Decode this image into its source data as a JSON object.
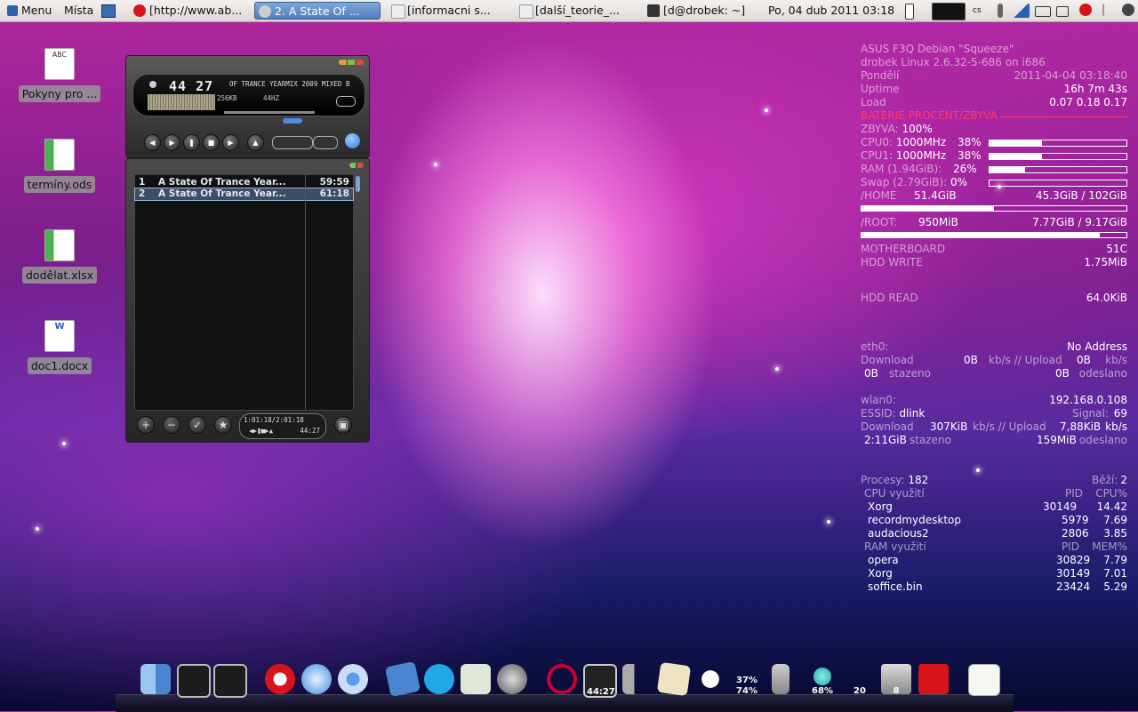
{
  "panel": {
    "menu_label": "Menu",
    "places_label": "Místa",
    "tasks": [
      {
        "label": "[http://www.ab..."
      },
      {
        "label": "2. A State Of ..."
      },
      {
        "label": "[informacni s..."
      },
      {
        "label": "[další_teorie_..."
      },
      {
        "label": "[d@drobek: ~]"
      }
    ],
    "clock": "Po, 04 dub 2011  03:18",
    "keyboard_layout": "cs"
  },
  "desktop_icons": [
    {
      "label": "Pokyny pro ...",
      "icon": "text-document-icon",
      "badge": "ABC"
    },
    {
      "label": "termíny.ods",
      "icon": "spreadsheet-icon"
    },
    {
      "label": "dodělat.xlsx",
      "icon": "spreadsheet-icon"
    },
    {
      "label": "doc1.docx",
      "icon": "word-document-icon",
      "badge": "W"
    }
  ],
  "player": {
    "time": "44 27",
    "marquee": "OF TRANCE YEARMIX 2009 MIXED B",
    "bitrate": "256KB",
    "samplerate": "44HZ",
    "playlist": [
      {
        "num": "1",
        "title": "A State Of Trance Year...",
        "length": "59:59"
      },
      {
        "num": "2",
        "title": "A State Of Trance Year...",
        "length": "61:18"
      }
    ],
    "mini_time": "1:01:18/2:01:18",
    "mini_elapsed": "44:27"
  },
  "conky": {
    "line1": "ASUS F3Q Debian \"Squeeze\"",
    "line2": "drobek Linux 2.6.32-5-686 on i686",
    "day_label": "Pondělí",
    "datetime": "2011-04-04 03:18:40",
    "uptime_label": "Uptime",
    "uptime": "16h 7m 43s",
    "load_label": "Load",
    "load": "0.07 0.18 0.17",
    "battery_header": "BATERIE PROCENT/ZBYVA",
    "zbyva_label": "ZBYVA:",
    "zbyva": "100%",
    "cpu0_label": "CPU0:",
    "cpu0_freq": "1000MHz",
    "cpu0_pct": "38%",
    "cpu0_level": 0.38,
    "cpu1_label": "CPU1:",
    "cpu1_freq": "1000MHz",
    "cpu1_pct": "38%",
    "cpu1_level": 0.38,
    "ram_label": "RAM (1.94GiB):",
    "ram_pct": "26%",
    "ram_level": 0.26,
    "swap_label": "Swap (2.79GiB):",
    "swap_pct": "0%",
    "swap_level": 0.0,
    "home_label": "/HOME",
    "home_used": "51.4GiB",
    "home_free": "45.3GiB / 102GiB",
    "home_level": 0.5,
    "root_label": "/ROOT:",
    "root_used": "950MiB",
    "root_free": "7.77GiB / 9.17GiB",
    "root_level": 0.9,
    "mb_label": "MOTHERBOARD",
    "mb_temp": "51C",
    "hddw_label": "HDD WRITE",
    "hddw": "1.75MiB",
    "hddr_label": "HDD READ",
    "hddr": "64.0KiB",
    "eth_label": "eth0:",
    "eth_addr": "No Address",
    "eth_down_label": "Download",
    "eth_down": "0B",
    "eth_sep": "kb/s // Upload",
    "eth_up": "0B",
    "eth_unit": "kb/s",
    "eth_total_down": "0B",
    "eth_total_down_label": "stazeno",
    "eth_total_up": "0B",
    "eth_total_up_label": "odeslano",
    "wlan_label": "wlan0:",
    "wlan_addr": "192.168.0.108",
    "essid_label": "ESSID:",
    "essid": "dlink",
    "signal_label": "Signal:",
    "signal": "69",
    "wlan_down_label": "Download",
    "wlan_down": "307KiB",
    "wlan_sep": "kb/s // Upload",
    "wlan_up": "7,88KiB",
    "wlan_unit": "kb/s",
    "wlan_total_down": "2:11GiB",
    "wlan_total_down_label": "stazeno",
    "wlan_total_up": "159MiB",
    "wlan_total_up_label": "odeslano",
    "procs_label": "Procesy:",
    "procs": "182",
    "running_label": "Běží:",
    "running": "2",
    "cpu_table_label": "CPU využití",
    "pid_label": "PID",
    "cpu_pct_label": "CPU%",
    "cpu_procs": [
      {
        "name": "Xorg",
        "pid": "30149",
        "val": "14.42"
      },
      {
        "name": "recordmydesktop",
        "pid": "5979",
        "val": "7.69"
      },
      {
        "name": "audacious2",
        "pid": "2806",
        "val": "3.85"
      }
    ],
    "ram_table_label": "RAM využití",
    "mem_pct_label": "MEM%",
    "ram_procs": [
      {
        "name": "opera",
        "pid": "30829",
        "val": "7.79"
      },
      {
        "name": "Xorg",
        "pid": "30149",
        "val": "7.01"
      },
      {
        "name": "soffice.bin",
        "pid": "23424",
        "val": "5.29"
      }
    ]
  },
  "dock": {
    "player_time": "44:27",
    "weather_top": "37%",
    "weather_bottom": "74%",
    "globe_pct": "68%",
    "count": "20",
    "trash_count": "8"
  },
  "colors": {
    "battery_header": "#ff3b6b",
    "task_active": "#4f7fbf",
    "opera_red": "#d8141b"
  }
}
